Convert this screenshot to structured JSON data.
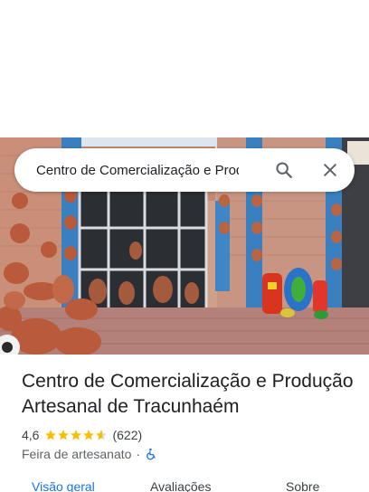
{
  "search": {
    "query": "Centro de Comercialização e Produção"
  },
  "place": {
    "title": "Centro de Comercialização e Produção Artesanal de Tracunhaém",
    "rating": "4,6",
    "rating_value": 4.6,
    "reviews_count": "(622)",
    "category": "Feira de artesanato",
    "separator": "·",
    "wheelchair_accessible": true
  },
  "tabs": [
    {
      "label": "Visão geral",
      "active": true
    },
    {
      "label": "Avaliações",
      "active": false
    },
    {
      "label": "Sobre",
      "active": false
    }
  ],
  "colors": {
    "accent": "#1a73e8",
    "star": "#fbbc04",
    "accessibility": "#1a73e8"
  }
}
